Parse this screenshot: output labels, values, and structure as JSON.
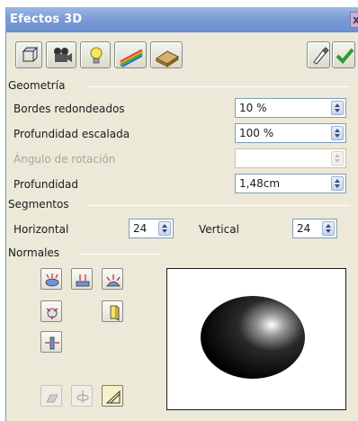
{
  "window": {
    "title": "Efectos 3D",
    "close_glyph": "x"
  },
  "toolbar": {
    "tabs": [
      {
        "name": "geometry-tab",
        "icon": "cube-icon"
      },
      {
        "name": "shading-tab",
        "icon": "camera-icon"
      },
      {
        "name": "illumination-tab",
        "icon": "light-bulb-icon"
      },
      {
        "name": "textures-tab",
        "icon": "rainbow-icon"
      },
      {
        "name": "material-tab",
        "icon": "material-icon"
      }
    ],
    "right": [
      {
        "name": "assign-button",
        "icon": "pipette-icon"
      },
      {
        "name": "update-button",
        "icon": "check-icon"
      }
    ]
  },
  "geometria": {
    "header": "Geometría",
    "rows": [
      {
        "label": "Bordes redondeados",
        "value": "10 %",
        "enabled": true
      },
      {
        "label": "Profundidad escalada",
        "value": "100 %",
        "enabled": true
      },
      {
        "label": "Ángulo de rotación",
        "value": "",
        "enabled": false
      },
      {
        "label": "Profundidad",
        "value": "1,48cm",
        "enabled": true
      }
    ]
  },
  "segmentos": {
    "header": "Segmentos",
    "horizontal_label": "Horizontal",
    "horizontal_value": "24",
    "vertical_label": "Vertical",
    "vertical_value": "24"
  },
  "normales": {
    "header": "Normales",
    "buttons": [
      "object-specific-normals-icon",
      "flat-normals-icon",
      "spherical-normals-icon",
      "invert-normals-icon",
      "double-sided-illumination-icon",
      "double-sided-icon",
      "convert-to-3d-icon",
      "convert-to-lathe-icon",
      "perspective-icon"
    ]
  },
  "colors": {
    "titlebar": "#7b9cd6",
    "dialog": "#ece9d8",
    "accent": "#4a78c2",
    "check": "#2e9a2e"
  }
}
